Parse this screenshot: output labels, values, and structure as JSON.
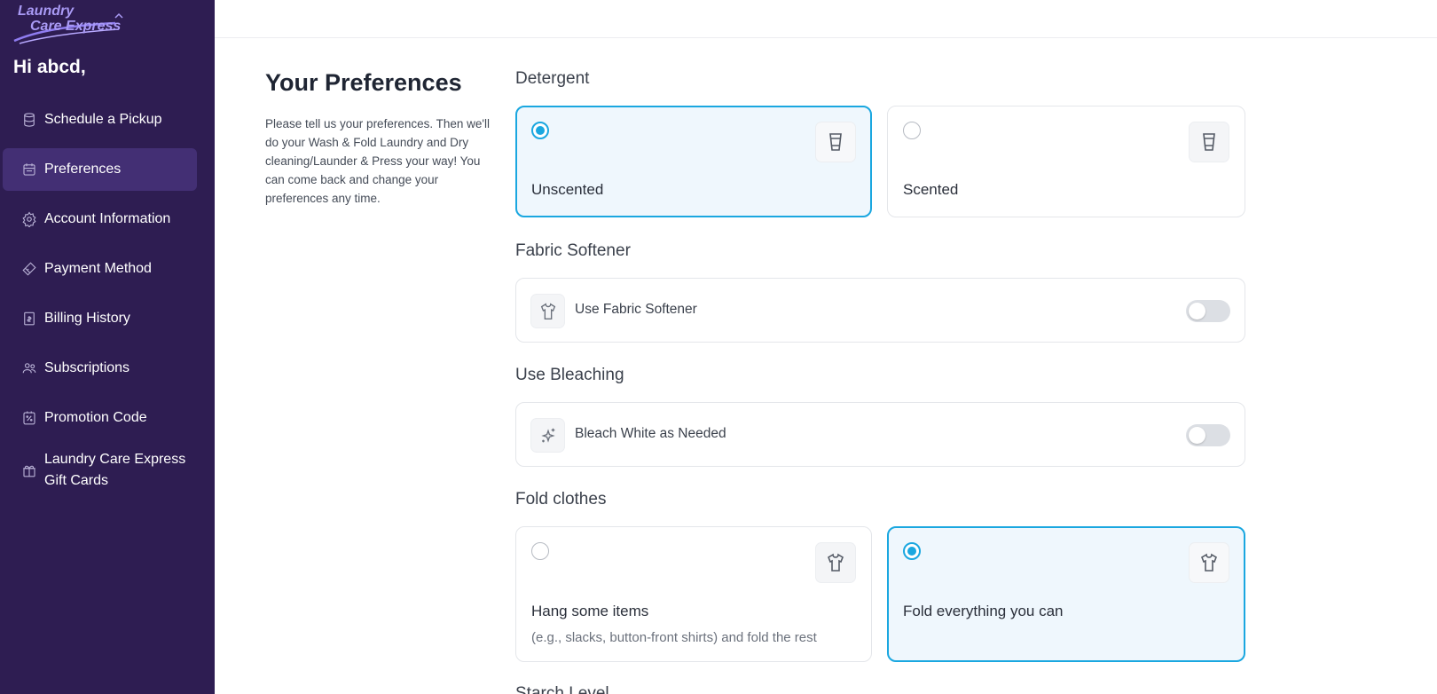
{
  "brand": {
    "logo_line1": "Laundry",
    "logo_line2": "Care Express"
  },
  "sidebar": {
    "greeting": "Hi abcd,",
    "items": [
      {
        "label": "Schedule a Pickup",
        "icon": "cylinder-icon"
      },
      {
        "label": "Preferences",
        "icon": "calendar-icon",
        "active": true
      },
      {
        "label": "Account Information",
        "icon": "gear-icon"
      },
      {
        "label": "Payment Method",
        "icon": "card-icon"
      },
      {
        "label": "Billing History",
        "icon": "receipt-icon"
      },
      {
        "label": "Subscriptions",
        "icon": "users-icon"
      },
      {
        "label": "Promotion Code",
        "icon": "discount-icon"
      },
      {
        "label": "Laundry Care Express Gift Cards",
        "icon": "gift-icon"
      }
    ]
  },
  "intro": {
    "title": "Your Preferences",
    "text": "Please tell us your preferences. Then we'll do your Wash & Fold Laundry and Dry cleaning/Launder & Press your way! You can come back and change your preferences any time."
  },
  "detergent": {
    "title": "Detergent",
    "options": [
      {
        "label": "Unscented",
        "selected": true,
        "icon": "cup-icon"
      },
      {
        "label": "Scented",
        "selected": false,
        "icon": "cup-icon"
      }
    ]
  },
  "fabric_softener": {
    "title": "Fabric Softener",
    "label": "Use Fabric Softener",
    "enabled": false,
    "icon": "shirt-icon"
  },
  "bleaching": {
    "title": "Use Bleaching",
    "label": "Bleach White as Needed",
    "enabled": false,
    "icon": "sparkle-icon"
  },
  "fold": {
    "title": "Fold clothes",
    "options": [
      {
        "label": "Hang some items",
        "sub": "(e.g., slacks, button-front shirts) and fold the rest",
        "selected": false,
        "icon": "shirt-icon"
      },
      {
        "label": "Fold everything you can",
        "selected": true,
        "icon": "shirt-icon"
      }
    ]
  },
  "next_section": {
    "title": "Starch Level"
  },
  "colors": {
    "sidebar_bg": "#2e1d52",
    "sidebar_active": "#432f74",
    "accent": "#1aa7e0"
  }
}
